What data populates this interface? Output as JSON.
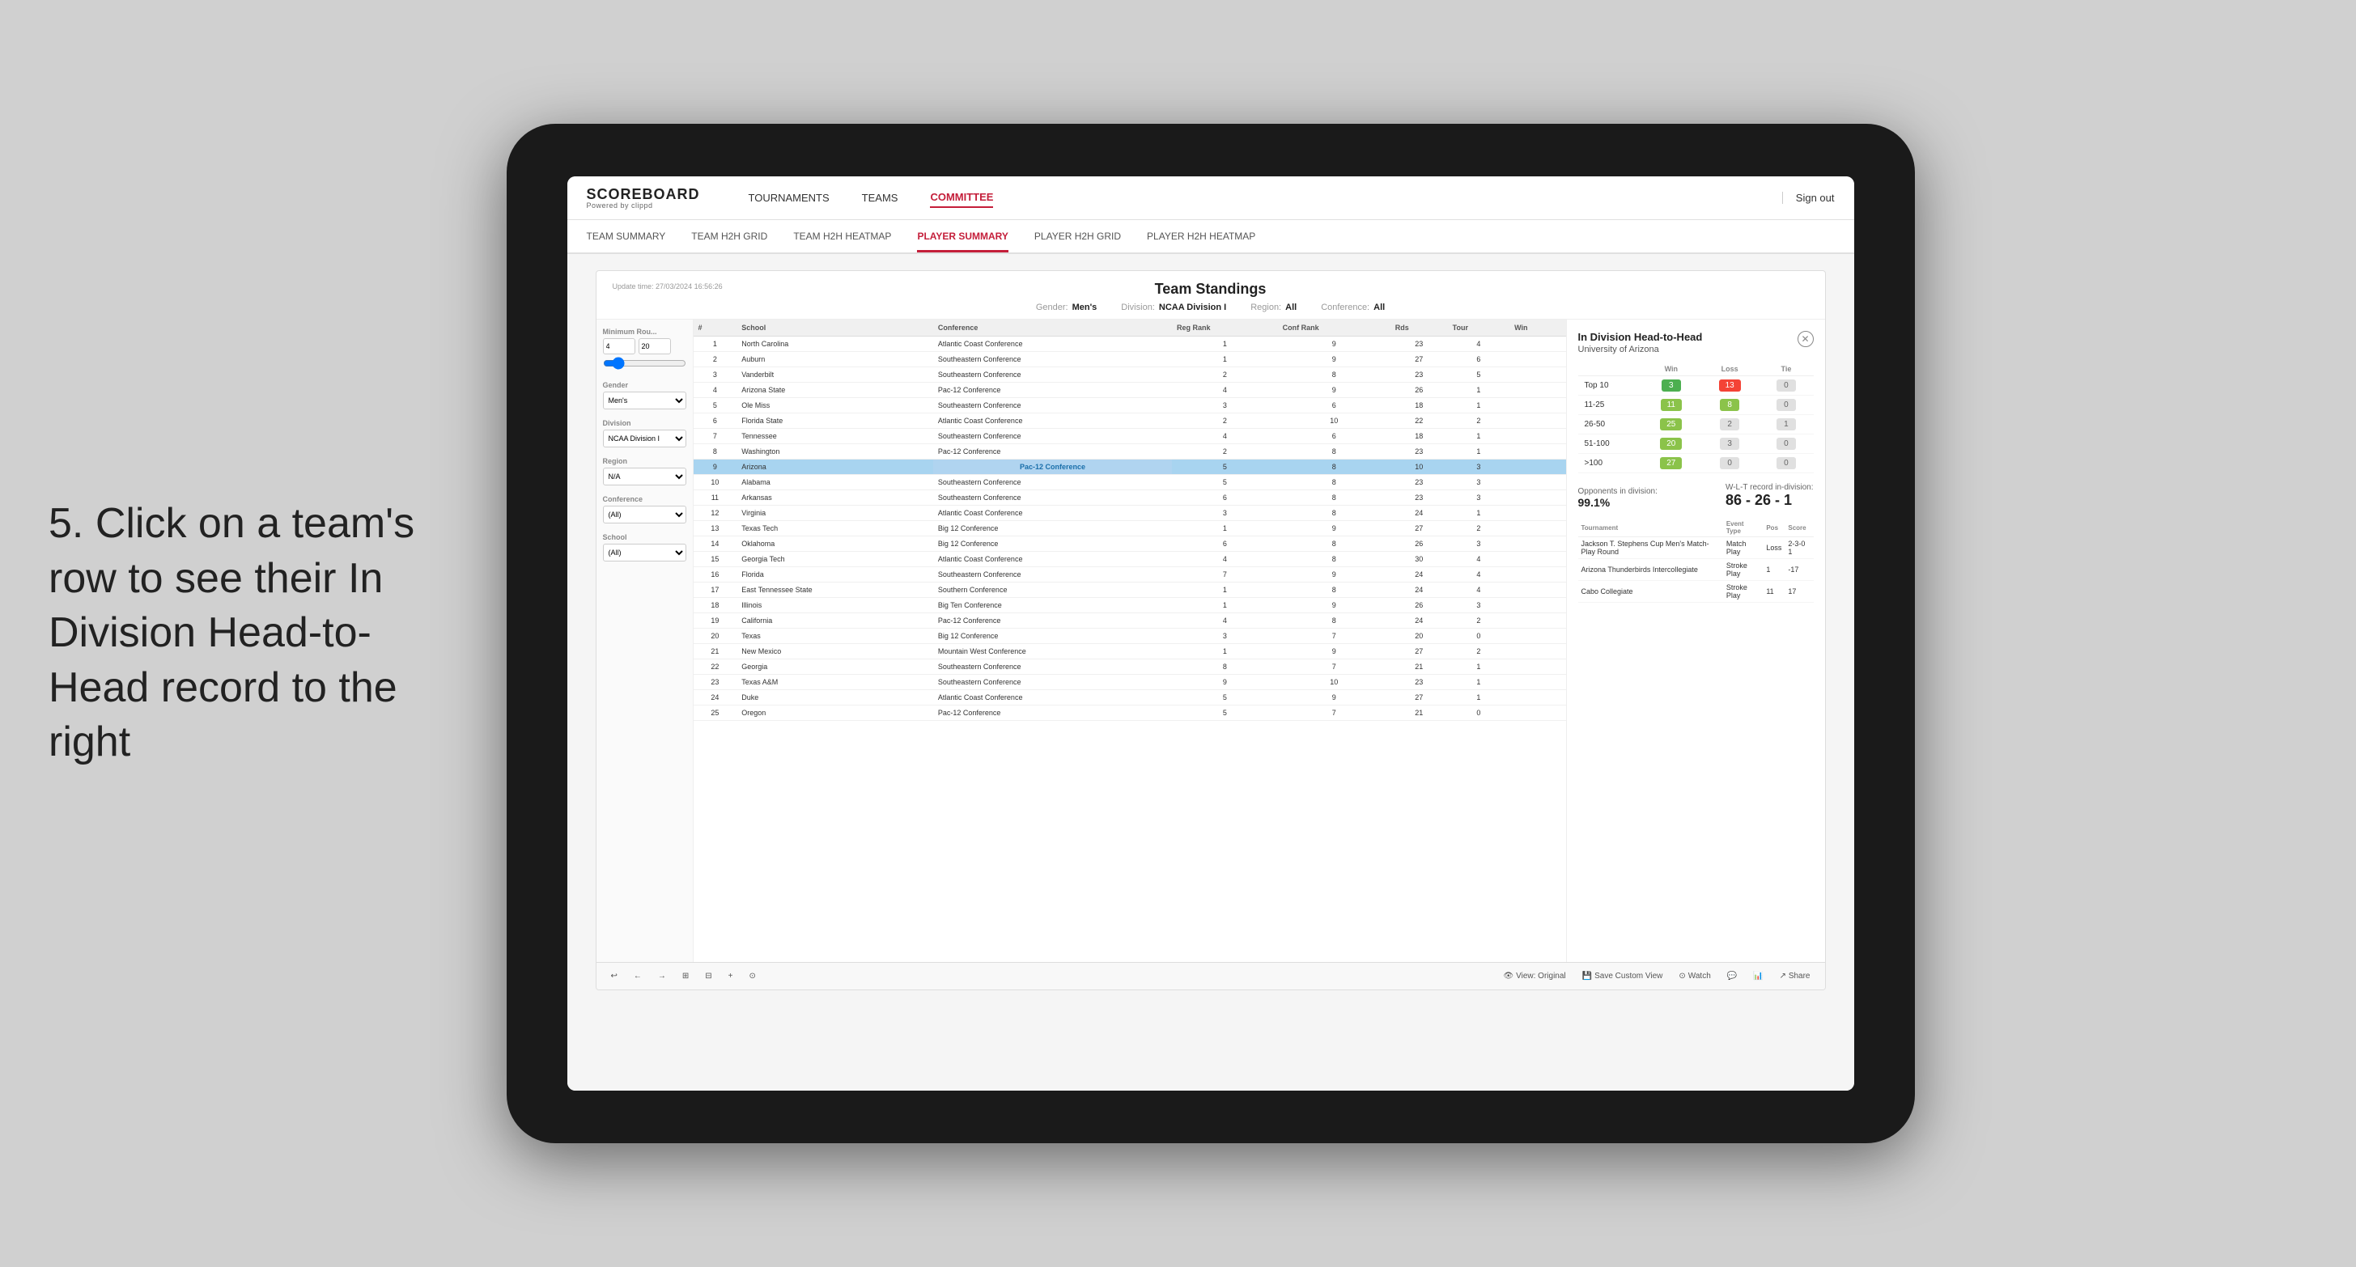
{
  "page": {
    "background": "#d5d5d5"
  },
  "instruction": {
    "text": "5. Click on a team's row to see their In Division Head-to-Head record to the right"
  },
  "nav": {
    "logo": "SCOREBOARD",
    "logo_sub": "Powered by clippd",
    "links": [
      "TOURNAMENTS",
      "TEAMS",
      "COMMITTEE"
    ],
    "active_link": "COMMITTEE",
    "sign_out": "Sign out"
  },
  "sub_nav": {
    "links": [
      "TEAM SUMMARY",
      "TEAM H2H GRID",
      "TEAM H2H HEATMAP",
      "PLAYER SUMMARY",
      "PLAYER H2H GRID",
      "PLAYER H2H HEATMAP"
    ],
    "active": "PLAYER SUMMARY"
  },
  "standings": {
    "title": "Team Standings",
    "update_time": "Update time:\n27/03/2024 16:56:26",
    "filters": {
      "gender_label": "Gender:",
      "gender_value": "Men's",
      "division_label": "Division:",
      "division_value": "NCAA Division I",
      "region_label": "Region:",
      "region_value": "All",
      "conference_label": "Conference:",
      "conference_value": "All"
    },
    "sidebar": {
      "min_rounds_label": "Minimum Rou...",
      "min_rounds_value": "4",
      "min_rounds_max": "20",
      "gender_label": "Gender",
      "gender_value": "Men's",
      "division_label": "Division",
      "division_value": "NCAA Division I",
      "region_label": "Region",
      "region_value": "N/A",
      "conference_label": "Conference",
      "conference_value": "(All)",
      "school_label": "School",
      "school_value": "(All)"
    },
    "table": {
      "headers": [
        "#",
        "School",
        "Conference",
        "Reg Rank",
        "Conf Rank",
        "Rds",
        "Tour",
        "Win"
      ],
      "rows": [
        {
          "rank": 1,
          "school": "North Carolina",
          "conference": "Atlantic Coast Conference",
          "reg_rank": 1,
          "conf_rank": 9,
          "rds": 23,
          "tour": 4,
          "win": ""
        },
        {
          "rank": 2,
          "school": "Auburn",
          "conference": "Southeastern Conference",
          "reg_rank": 1,
          "conf_rank": 9,
          "rds": 27,
          "tour": 6,
          "win": ""
        },
        {
          "rank": 3,
          "school": "Vanderbilt",
          "conference": "Southeastern Conference",
          "reg_rank": 2,
          "conf_rank": 8,
          "rds": 23,
          "tour": 5,
          "win": ""
        },
        {
          "rank": 4,
          "school": "Arizona State",
          "conference": "Pac-12 Conference",
          "reg_rank": 4,
          "conf_rank": 9,
          "rds": 26,
          "tour": 1,
          "win": ""
        },
        {
          "rank": 5,
          "school": "Ole Miss",
          "conference": "Southeastern Conference",
          "reg_rank": 3,
          "conf_rank": 6,
          "rds": 18,
          "tour": 1,
          "win": ""
        },
        {
          "rank": 6,
          "school": "Florida State",
          "conference": "Atlantic Coast Conference",
          "reg_rank": 2,
          "conf_rank": 10,
          "rds": 22,
          "tour": 2,
          "win": ""
        },
        {
          "rank": 7,
          "school": "Tennessee",
          "conference": "Southeastern Conference",
          "reg_rank": 4,
          "conf_rank": 6,
          "rds": 18,
          "tour": 1,
          "win": ""
        },
        {
          "rank": 8,
          "school": "Washington",
          "conference": "Pac-12 Conference",
          "reg_rank": 2,
          "conf_rank": 8,
          "rds": 23,
          "tour": 1,
          "win": ""
        },
        {
          "rank": 9,
          "school": "Arizona",
          "conference": "Pac-12 Conference",
          "reg_rank": 5,
          "conf_rank": 8,
          "rds": 10,
          "tour": 3,
          "win": "",
          "selected": true
        },
        {
          "rank": 10,
          "school": "Alabama",
          "conference": "Southeastern Conference",
          "reg_rank": 5,
          "conf_rank": 8,
          "rds": 23,
          "tour": 3,
          "win": ""
        },
        {
          "rank": 11,
          "school": "Arkansas",
          "conference": "Southeastern Conference",
          "reg_rank": 6,
          "conf_rank": 8,
          "rds": 23,
          "tour": 3,
          "win": ""
        },
        {
          "rank": 12,
          "school": "Virginia",
          "conference": "Atlantic Coast Conference",
          "reg_rank": 3,
          "conf_rank": 8,
          "rds": 24,
          "tour": 1,
          "win": ""
        },
        {
          "rank": 13,
          "school": "Texas Tech",
          "conference": "Big 12 Conference",
          "reg_rank": 1,
          "conf_rank": 9,
          "rds": 27,
          "tour": 2,
          "win": ""
        },
        {
          "rank": 14,
          "school": "Oklahoma",
          "conference": "Big 12 Conference",
          "reg_rank": 6,
          "conf_rank": 8,
          "rds": 26,
          "tour": 3,
          "win": ""
        },
        {
          "rank": 15,
          "school": "Georgia Tech",
          "conference": "Atlantic Coast Conference",
          "reg_rank": 4,
          "conf_rank": 8,
          "rds": 30,
          "tour": 4,
          "win": ""
        },
        {
          "rank": 16,
          "school": "Florida",
          "conference": "Southeastern Conference",
          "reg_rank": 7,
          "conf_rank": 9,
          "rds": 24,
          "tour": 4,
          "win": ""
        },
        {
          "rank": 17,
          "school": "East Tennessee State",
          "conference": "Southern Conference",
          "reg_rank": 1,
          "conf_rank": 8,
          "rds": 24,
          "tour": 4,
          "win": ""
        },
        {
          "rank": 18,
          "school": "Illinois",
          "conference": "Big Ten Conference",
          "reg_rank": 1,
          "conf_rank": 9,
          "rds": 26,
          "tour": 3,
          "win": ""
        },
        {
          "rank": 19,
          "school": "California",
          "conference": "Pac-12 Conference",
          "reg_rank": 4,
          "conf_rank": 8,
          "rds": 24,
          "tour": 2,
          "win": ""
        },
        {
          "rank": 20,
          "school": "Texas",
          "conference": "Big 12 Conference",
          "reg_rank": 3,
          "conf_rank": 7,
          "rds": 20,
          "tour": 0,
          "win": ""
        },
        {
          "rank": 21,
          "school": "New Mexico",
          "conference": "Mountain West Conference",
          "reg_rank": 1,
          "conf_rank": 9,
          "rds": 27,
          "tour": 2,
          "win": ""
        },
        {
          "rank": 22,
          "school": "Georgia",
          "conference": "Southeastern Conference",
          "reg_rank": 8,
          "conf_rank": 7,
          "rds": 21,
          "tour": 1,
          "win": ""
        },
        {
          "rank": 23,
          "school": "Texas A&M",
          "conference": "Southeastern Conference",
          "reg_rank": 9,
          "conf_rank": 10,
          "rds": 23,
          "tour": 1,
          "win": ""
        },
        {
          "rank": 24,
          "school": "Duke",
          "conference": "Atlantic Coast Conference",
          "reg_rank": 5,
          "conf_rank": 9,
          "rds": 27,
          "tour": 1,
          "win": ""
        },
        {
          "rank": 25,
          "school": "Oregon",
          "conference": "Pac-12 Conference",
          "reg_rank": 5,
          "conf_rank": 7,
          "rds": 21,
          "tour": 0,
          "win": ""
        }
      ]
    },
    "h2h": {
      "title": "In Division Head-to-Head",
      "school": "University of Arizona",
      "col_headers": [
        "",
        "Win",
        "Loss",
        "Tie"
      ],
      "rows": [
        {
          "label": "Top 10",
          "win": 3,
          "loss": 13,
          "tie": 0,
          "win_color": "green",
          "loss_color": "red",
          "tie_color": "gray"
        },
        {
          "label": "11-25",
          "win": 11,
          "loss": 8,
          "tie": 0,
          "win_color": "olive",
          "loss_color": "olive",
          "tie_color": "gray"
        },
        {
          "label": "26-50",
          "win": 25,
          "loss": 2,
          "tie": 1,
          "win_color": "olive",
          "loss_color": "gray",
          "tie_color": "gray"
        },
        {
          "label": "51-100",
          "win": 20,
          "loss": 3,
          "tie": 0,
          "win_color": "olive",
          "loss_color": "gray",
          "tie_color": "gray"
        },
        {
          "label": ">100",
          "win": 27,
          "loss": 0,
          "tie": 0,
          "win_color": "olive",
          "loss_color": "gray",
          "tie_color": "gray"
        }
      ],
      "opponents_label": "Opponents in division:",
      "opponents_value": "99.1%",
      "wlt_label": "W-L-T record in-division:",
      "wlt_value": "86 - 26 - 1",
      "tournaments": {
        "headers": [
          "Tournament",
          "Event Type",
          "Pos",
          "Score"
        ],
        "rows": [
          {
            "tournament": "Jackson T. Stephens Cup Men's Match-Play Round",
            "event_type": "Match Play",
            "pos": "Loss",
            "score": "2-3-0 1"
          },
          {
            "tournament": "Arizona Thunderbirds Intercollegiate",
            "event_type": "Stroke Play",
            "pos": "1",
            "score": "-17"
          },
          {
            "tournament": "Cabo Collegiate",
            "event_type": "Stroke Play",
            "pos": "11",
            "score": "17"
          }
        ]
      }
    }
  },
  "toolbar": {
    "buttons": [
      "↩",
      "←",
      "→",
      "⊞",
      "⊟",
      "+",
      "⊙",
      "View: Original",
      "Save Custom View",
      "Watch",
      "💬",
      "📊",
      "Share"
    ]
  }
}
